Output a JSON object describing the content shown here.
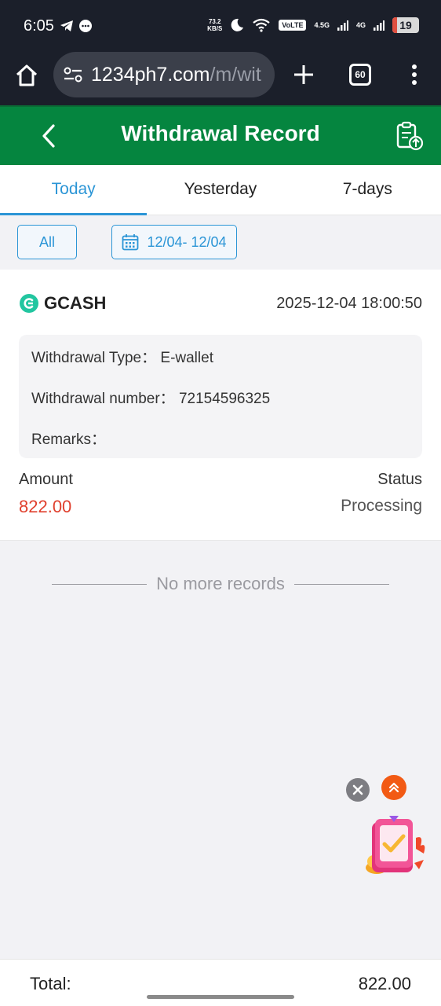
{
  "status_bar": {
    "time": "6:05",
    "speed_top": "73.2",
    "speed_unit": "KB/S",
    "volte": "VoLTE",
    "net1": "4.5G",
    "net2": "4G",
    "battery": "19"
  },
  "browser": {
    "url_host": "1234ph7.com",
    "url_path": "/m/wit",
    "tab_count": "60"
  },
  "header": {
    "title": "Withdrawal Record"
  },
  "tabs": [
    {
      "label": "Today",
      "active": true
    },
    {
      "label": "Yesterday",
      "active": false
    },
    {
      "label": "7-days",
      "active": false
    }
  ],
  "filters": {
    "all_label": "All",
    "date_range": "12/04- 12/04"
  },
  "record": {
    "method": "GCASH",
    "datetime": "2025-12-04 18:00:50",
    "type_label": "Withdrawal Type：",
    "type_value": "E-wallet",
    "number_label": "Withdrawal number：",
    "number_value": "72154596325",
    "remarks_label": "Remarks：",
    "remarks_value": "",
    "amount_label": "Amount",
    "amount_value": "822.00",
    "status_label": "Status",
    "status_value": "Processing"
  },
  "list_end": "No more records",
  "footer": {
    "total_label": "Total:",
    "total_value": "822.00"
  },
  "colors": {
    "header_green": "#05853f",
    "accent_blue": "#2b95d6",
    "amount_red": "#e0402e",
    "gcash_teal": "#22c6a0"
  }
}
